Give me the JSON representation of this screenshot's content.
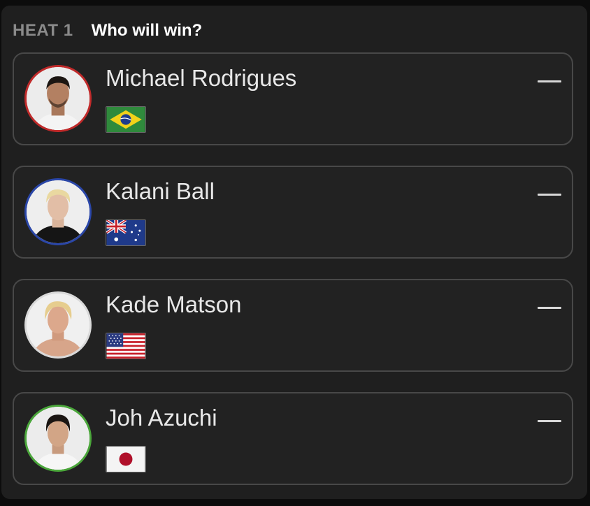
{
  "header": {
    "heat_label": "HEAT 1",
    "question": "Who will win?"
  },
  "surfers": [
    {
      "name": "Michael Rodrigues",
      "country": "Brazil",
      "ring_color": "#c02a2a",
      "icon": "minus-icon"
    },
    {
      "name": "Kalani Ball",
      "country": "Australia",
      "ring_color": "#2a46a8",
      "icon": "minus-icon"
    },
    {
      "name": "Kade Matson",
      "country": "USA",
      "ring_color": "#d9d9d9",
      "icon": "minus-icon"
    },
    {
      "name": "Joh Azuchi",
      "country": "Japan",
      "ring_color": "#4aa63a",
      "icon": "minus-icon"
    }
  ]
}
